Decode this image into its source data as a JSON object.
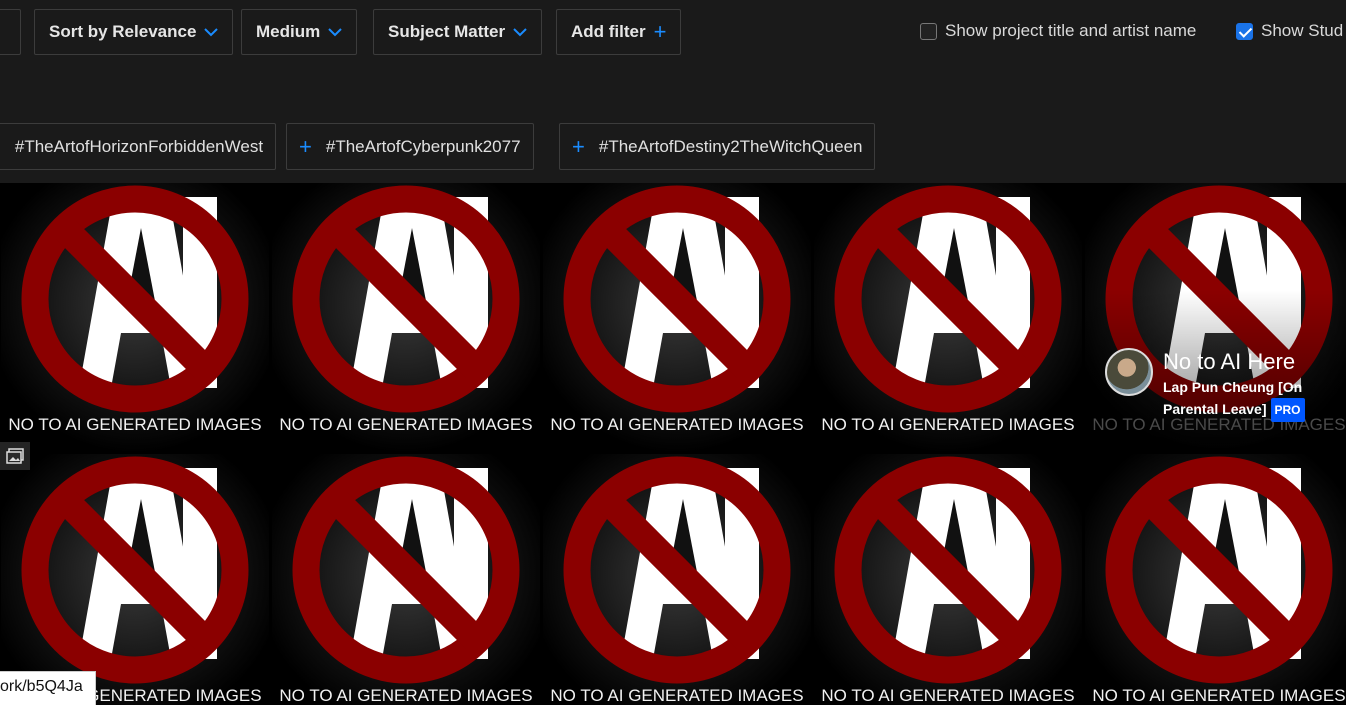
{
  "filters": {
    "sort_label": "Sort by Relevance",
    "medium_label": "Medium",
    "subject_label": "Subject Matter",
    "add_filter_label": "Add filter"
  },
  "options": {
    "show_title_label": "Show project title and artist name",
    "show_title_checked": false,
    "show_studio_label": "Show Stud",
    "show_studio_checked": true
  },
  "tags": [
    "#TheArtofHorizonForbiddenWest",
    "#TheArtofCyberpunk2077",
    "#TheArtofDestiny2TheWitchQueen"
  ],
  "tiles": {
    "logo_text": "AI",
    "caption": "NO TO AI GENERATED IMAGES",
    "hovered": {
      "title": "No to AI Here",
      "owner": "Lap Pun Cheung [On Parental Leave]",
      "badge": "PRO"
    }
  },
  "status_bar": {
    "url": "ork/b5Q4Ja"
  },
  "colors": {
    "accent": "#1a8cff",
    "ban_red": "#8b0000",
    "pro_badge": "#0057ff"
  }
}
